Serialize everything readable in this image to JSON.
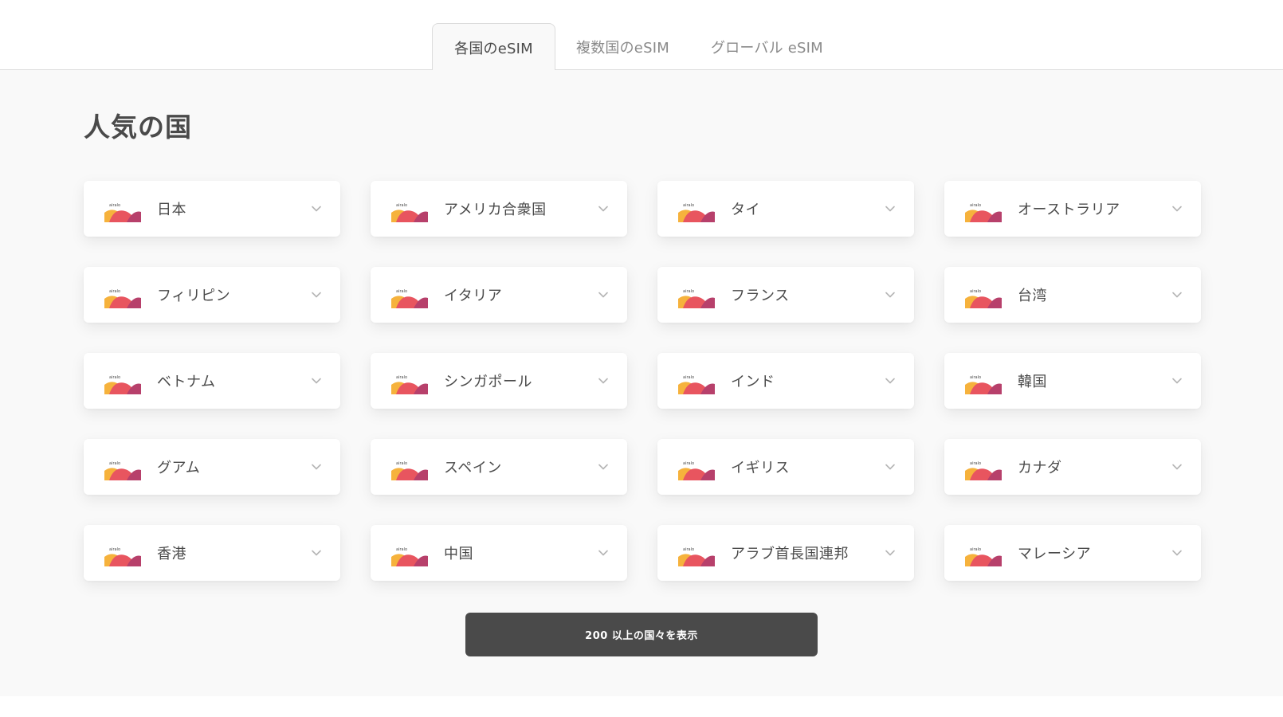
{
  "tabs": [
    {
      "label": "各国のeSIM",
      "active": true
    },
    {
      "label": "複数国のeSIM",
      "active": false
    },
    {
      "label": "グローバル eSIM",
      "active": false
    }
  ],
  "section": {
    "title": "人気の国"
  },
  "logo_text": "airalo",
  "logo_colors": [
    "#f6b23c",
    "#e8555f",
    "#b7406b"
  ],
  "countries": [
    {
      "name": "日本"
    },
    {
      "name": "アメリカ合衆国"
    },
    {
      "name": "タイ"
    },
    {
      "name": "オーストラリア"
    },
    {
      "name": "フィリピン"
    },
    {
      "name": "イタリア"
    },
    {
      "name": "フランス"
    },
    {
      "name": "台湾"
    },
    {
      "name": "ベトナム"
    },
    {
      "name": "シンガポール"
    },
    {
      "name": "インド"
    },
    {
      "name": "韓国"
    },
    {
      "name": "グアム"
    },
    {
      "name": "スペイン"
    },
    {
      "name": "イギリス"
    },
    {
      "name": "カナダ"
    },
    {
      "name": "香港"
    },
    {
      "name": "中国"
    },
    {
      "name": "アラブ首長国連邦"
    },
    {
      "name": "マレーシア"
    }
  ],
  "more_button": {
    "label": "200 以上の国々を表示"
  }
}
